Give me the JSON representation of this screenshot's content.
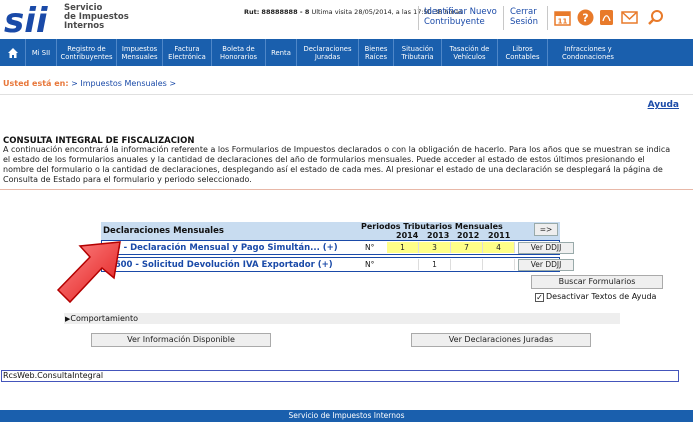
{
  "header": {
    "logo_text_1": "Servicio",
    "logo_text_2": "de Impuestos",
    "logo_text_3": "Internos",
    "rut_label": "Rut:",
    "rut_value": "88888888 - 8",
    "last_visit": "Ultima visita 28/05/2014, a las 17:50:38 horas",
    "identify_line1": "Identificar Nuevo",
    "identify_line2": "Contribuyente",
    "logout_line1": "Cerrar",
    "logout_line2": "Sesión",
    "icons": [
      "calendar-icon",
      "help-icon",
      "pdf-icon",
      "mail-icon",
      "search-icon"
    ],
    "colors": {
      "logo_blue": "#1a4aa8",
      "icon_orange": "#e87a2a"
    }
  },
  "nav": {
    "home_icon": "home-icon",
    "items": [
      {
        "l1": "Mi SII",
        "l2": ""
      },
      {
        "l1": "Registro de",
        "l2": "Contribuyentes"
      },
      {
        "l1": "Impuestos",
        "l2": "Mensuales"
      },
      {
        "l1": "Factura",
        "l2": "Electrónica"
      },
      {
        "l1": "Boleta de",
        "l2": "Honorarios"
      },
      {
        "l1": "Renta",
        "l2": ""
      },
      {
        "l1": "Declaraciones",
        "l2": "Juradas"
      },
      {
        "l1": "Bienes",
        "l2": "Raíces"
      },
      {
        "l1": "Situación",
        "l2": "Tributaria"
      },
      {
        "l1": "Tasación de",
        "l2": "Vehículos"
      },
      {
        "l1": "Libros",
        "l2": "Contables"
      },
      {
        "l1": "Infracciones y",
        "l2": "Condonaciones"
      }
    ],
    "color": "#1a5fad"
  },
  "breadcrumb": {
    "label": "Usted está en:",
    "path": "> Impuestos Mensuales  >"
  },
  "help": "Ayuda",
  "page": {
    "title": "CONSULTA INTEGRAL DE FISCALIZACION",
    "description": "A continuación encontrará la información referente a los Formularios de Impuestos declarados o con la obligación de hacerlo. Para los años que se muestran se indica el estado de los formularios anuales y la cantidad de declaraciones del año de formularios mensuales. Puede acceder al estado de estos últimos presionando el nombre del formulario o la cantidad de declaraciones, desplegando así el estado de cada mes. Al presionar el estado de una declaración se desplegará la página de Consulta de Estado para el formulario y periodo seleccionado."
  },
  "table": {
    "header_label": "Declaraciones Mensuales",
    "periods_label": "Periodos Tributarios Mensuales",
    "years": [
      "2014",
      "2013",
      "2012",
      "2011"
    ],
    "next_button": "=>",
    "rows": [
      {
        "name": "F29 - Declaración Mensual y Pago Simultán... (+)",
        "num_label": "N°",
        "values": [
          "1",
          "3",
          "7",
          "4"
        ],
        "highlight": [
          true,
          true,
          true,
          true
        ],
        "button": "Ver DDJJ"
      },
      {
        "name": "F4600 - Solicitud Devolución IVA Exportador (+)",
        "num_label": "N°",
        "values": [
          "",
          "1",
          "",
          ""
        ],
        "highlight": [
          false,
          false,
          false,
          false
        ],
        "button": "Ver DDJJ"
      }
    ]
  },
  "actions": {
    "search_forms": "Buscar Formularios",
    "disable_help_label": "Desactivar Textos de Ayuda",
    "disable_help_checked": true,
    "behaviour": "Comportamiento",
    "available_info": "Ver Información Disponible",
    "sworn_declarations": "Ver Declaraciones Juradas"
  },
  "rcs": "RcsWeb.ConsultaIntegral",
  "footer": "Servicio de Impuestos Internos"
}
